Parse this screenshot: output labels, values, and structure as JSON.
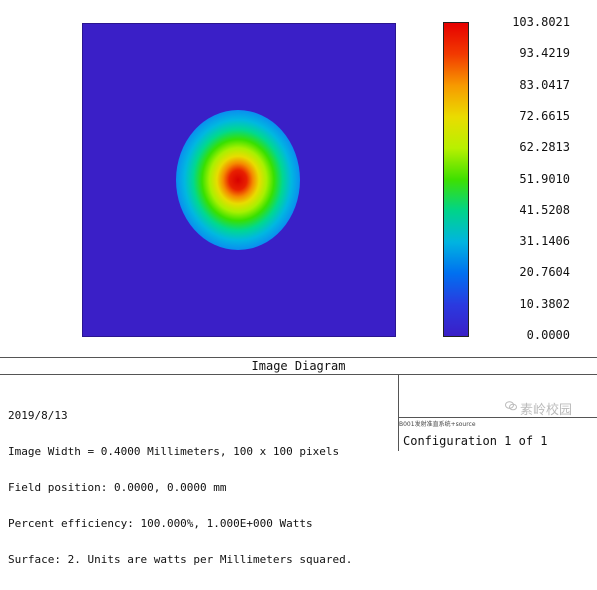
{
  "colorbar": {
    "labels": [
      "103.8021",
      "93.4219",
      "83.0417",
      "72.6615",
      "62.2813",
      "51.9010",
      "41.5208",
      "31.1406",
      "20.7604",
      "10.3802",
      "0.0000"
    ]
  },
  "diagram": {
    "title": "Image Diagram",
    "info": {
      "date": "2019/8/13",
      "image_width": "Image Width = 0.4000 Millimeters, 100 x 100 pixels",
      "field_position": "Field position: 0.0000, 0.0000 mm",
      "percent_efficiency": "Percent efficiency: 100.000%, 1.000E+000 Watts",
      "surface": "Surface: 2. Units are watts per Millimeters squared."
    },
    "file_name": "B001发射准直系统+source",
    "configuration": "Configuration 1 of 1"
  },
  "watermark": "素岭校园",
  "colors": {
    "background_field": "#3a1fc7",
    "peak": "#e60000"
  }
}
